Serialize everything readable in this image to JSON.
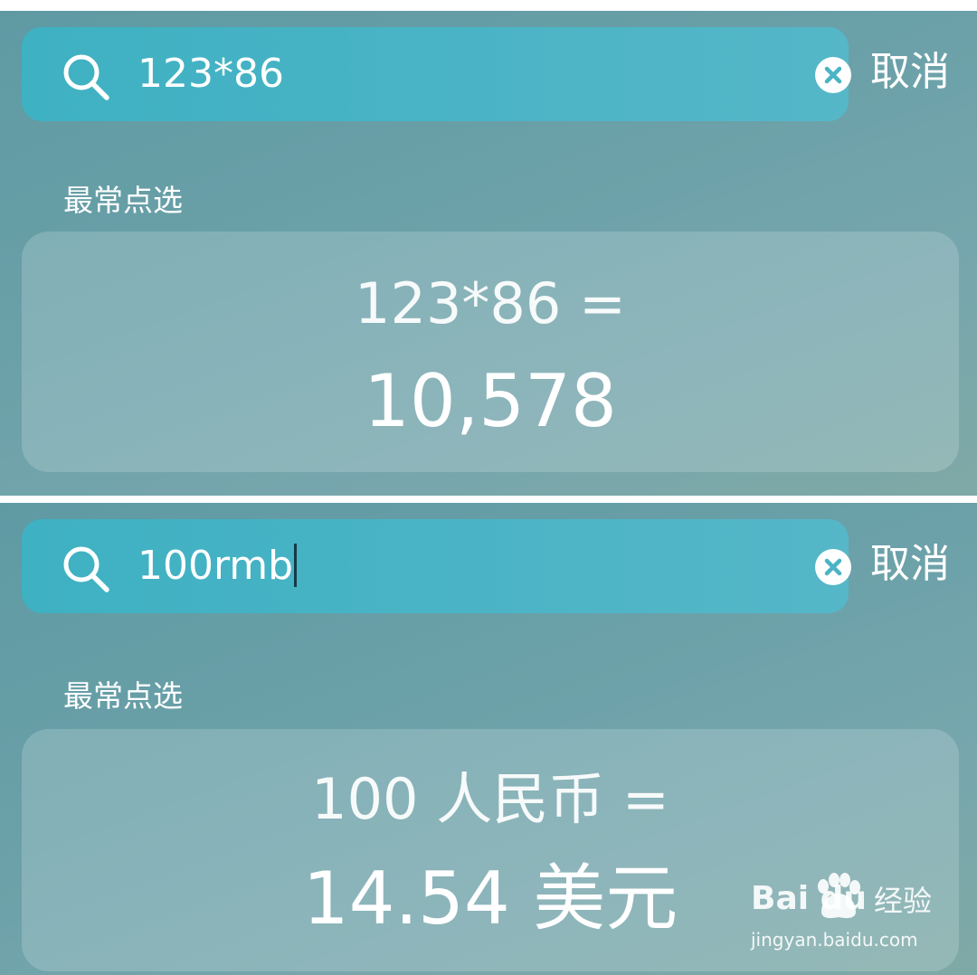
{
  "panels": [
    {
      "search": {
        "query": "123*86",
        "cancel_label": "取消"
      },
      "section_label": "最常点选",
      "result": {
        "expression": "123*86 =",
        "value": "10,578"
      }
    },
    {
      "search": {
        "query": "100rmb",
        "cancel_label": "取消"
      },
      "section_label": "最常点选",
      "result": {
        "expression": "100 人民币 =",
        "value": "14.54 美元"
      }
    }
  ],
  "icons": {
    "search": "search-icon",
    "clear": "clear-icon",
    "watermark_paw": "paw-icon"
  },
  "watermark": {
    "logo_text": "Bai  du",
    "brand": "经验",
    "url": "jingyan.baidu.com"
  },
  "colors": {
    "panel_bg": "#6aa0a8",
    "search_bar": "#4ab4c6",
    "text": "#ffffff"
  }
}
